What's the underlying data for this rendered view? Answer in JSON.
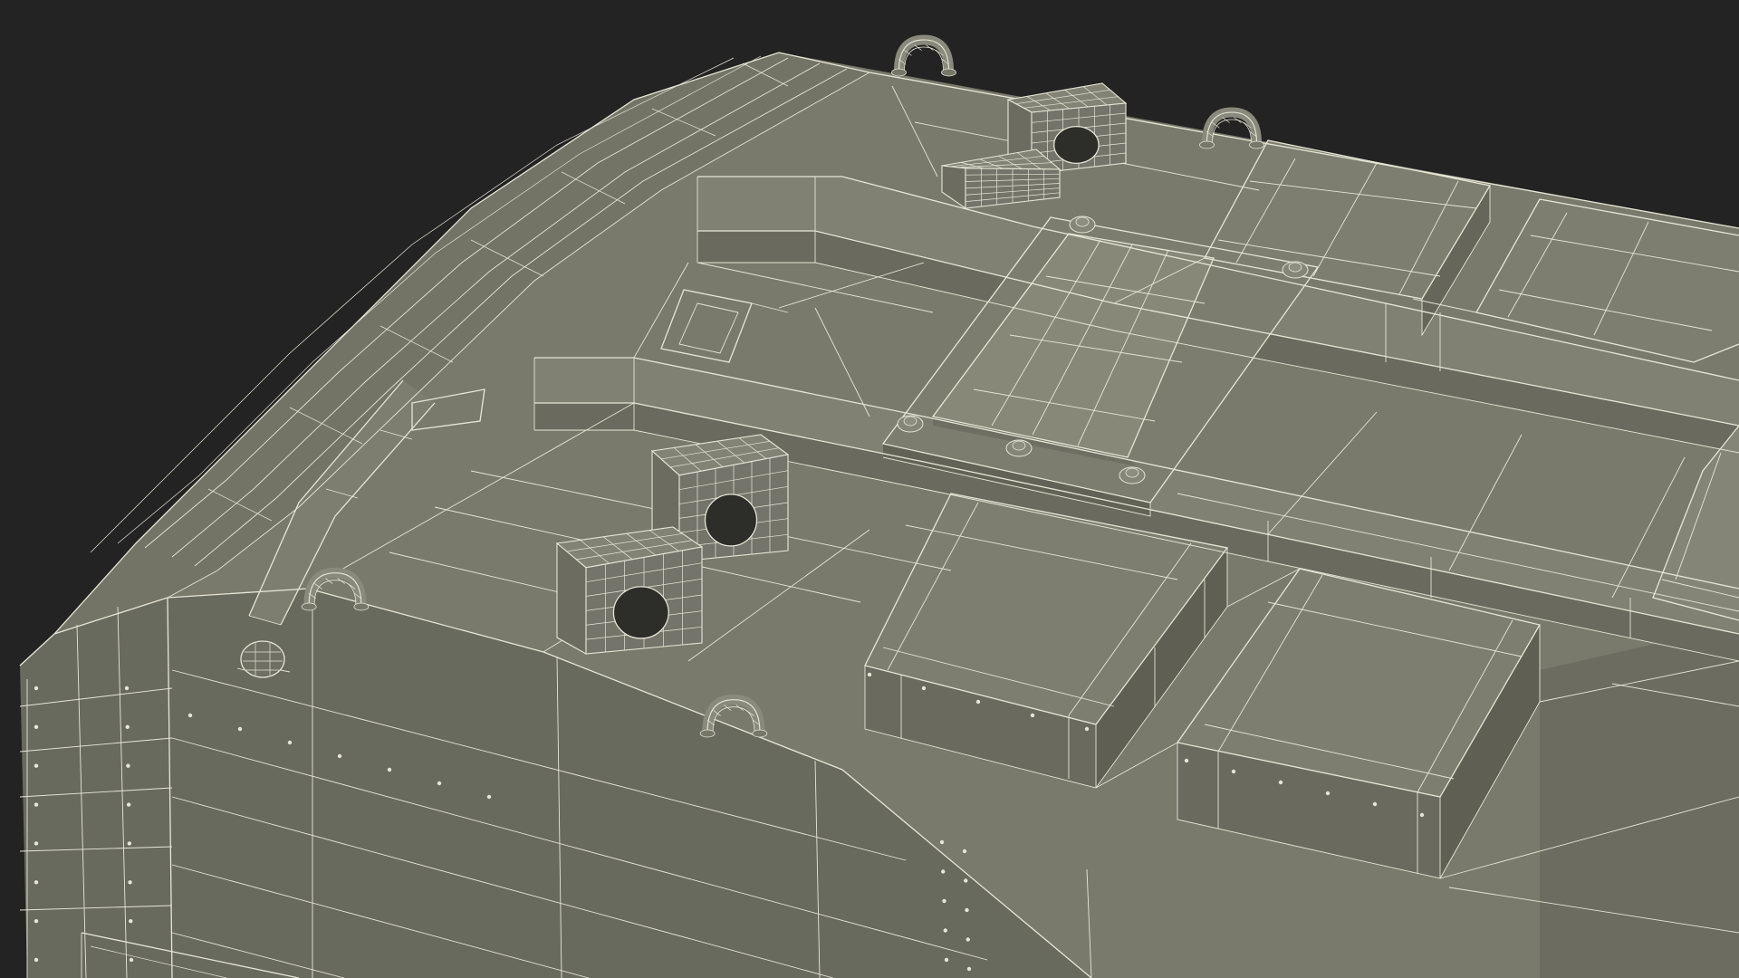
{
  "scene": {
    "subject": "wireframe-hull-model",
    "colors": {
      "background": "#232323",
      "surface_top": "#7a7a6c",
      "surface_mid": "#727265",
      "surface_side": "#68685c",
      "surface_dark": "#5e5e53",
      "wire": "#e6e6d6"
    },
    "icons": [
      "grab-handle-icon",
      "bolt-icon",
      "vent-port-icon"
    ]
  }
}
